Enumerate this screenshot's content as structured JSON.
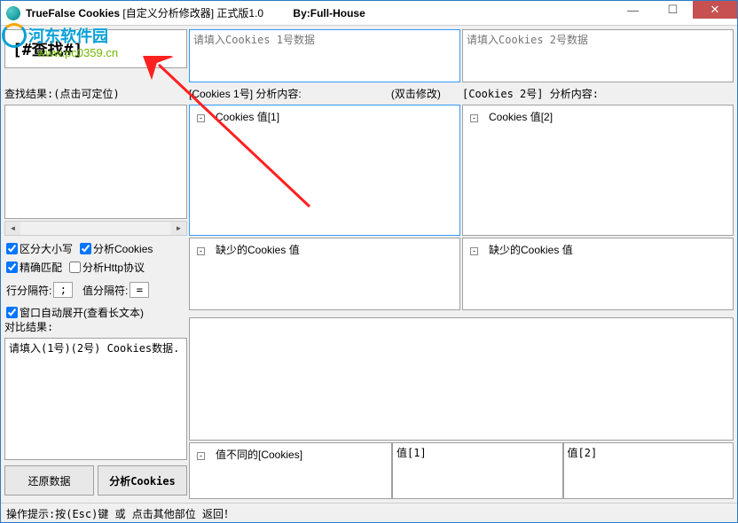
{
  "titlebar": {
    "app_name": "TrueFalse Cookies",
    "subtitle": "[自定义分析修改器] 正式版1.0",
    "by_label": "By:Full-House"
  },
  "watermark": {
    "site_name": "河东软件园",
    "url": "www.pc0359.cn"
  },
  "search": {
    "value": "[#查找#]",
    "results_label": "查找结果:(点击可定位)"
  },
  "options": {
    "case_sensitive": "区分大小写",
    "analyze_cookies": "分析Cookies",
    "exact_match": "精确匹配",
    "analyze_http": "分析Http协议",
    "line_sep_label": "行分隔符:",
    "line_sep_value": ";",
    "val_sep_label": "值分隔符:",
    "val_sep_value": "=",
    "auto_expand": "窗口自动展开(查看长文本)"
  },
  "compare": {
    "label": "对比结果:",
    "text": "请填入(1号)(2号) Cookies数据."
  },
  "buttons": {
    "restore": "还原数据",
    "analyze": "分析Cookies"
  },
  "cookies1": {
    "placeholder": "请填入Cookies 1号数据",
    "analysis_label": "[Cookies 1号] 分析内容:",
    "double_click": "(双击修改)",
    "tree_item": "Cookies 值[1]",
    "missing": "缺少的Cookies 值"
  },
  "cookies2": {
    "placeholder": "请填入Cookies 2号数据",
    "analysis_label": "[Cookies 2号] 分析内容:",
    "tree_item": "Cookies 值[2]",
    "missing": "缺少的Cookies 值"
  },
  "diff": {
    "col1": "值不同的[Cookies]",
    "col2": "值[1]",
    "col3": "值[2]"
  },
  "statusbar": "操作提示:按(Esc)键 或 点击其他部位 返回！"
}
